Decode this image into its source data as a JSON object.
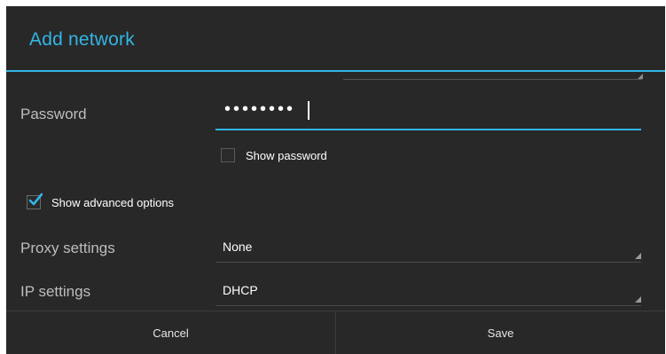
{
  "dialog": {
    "title": "Add network"
  },
  "password": {
    "label": "Password",
    "masked_value": "••••••••"
  },
  "show_password": {
    "label": "Show password",
    "checked": false
  },
  "advanced": {
    "label": "Show advanced options",
    "checked": true
  },
  "proxy": {
    "label": "Proxy settings",
    "value": "None"
  },
  "ip": {
    "label": "IP settings",
    "value": "DHCP"
  },
  "buttons": {
    "cancel": "Cancel",
    "save": "Save"
  },
  "colors": {
    "accent": "#33b5e5",
    "background": "#282828"
  }
}
